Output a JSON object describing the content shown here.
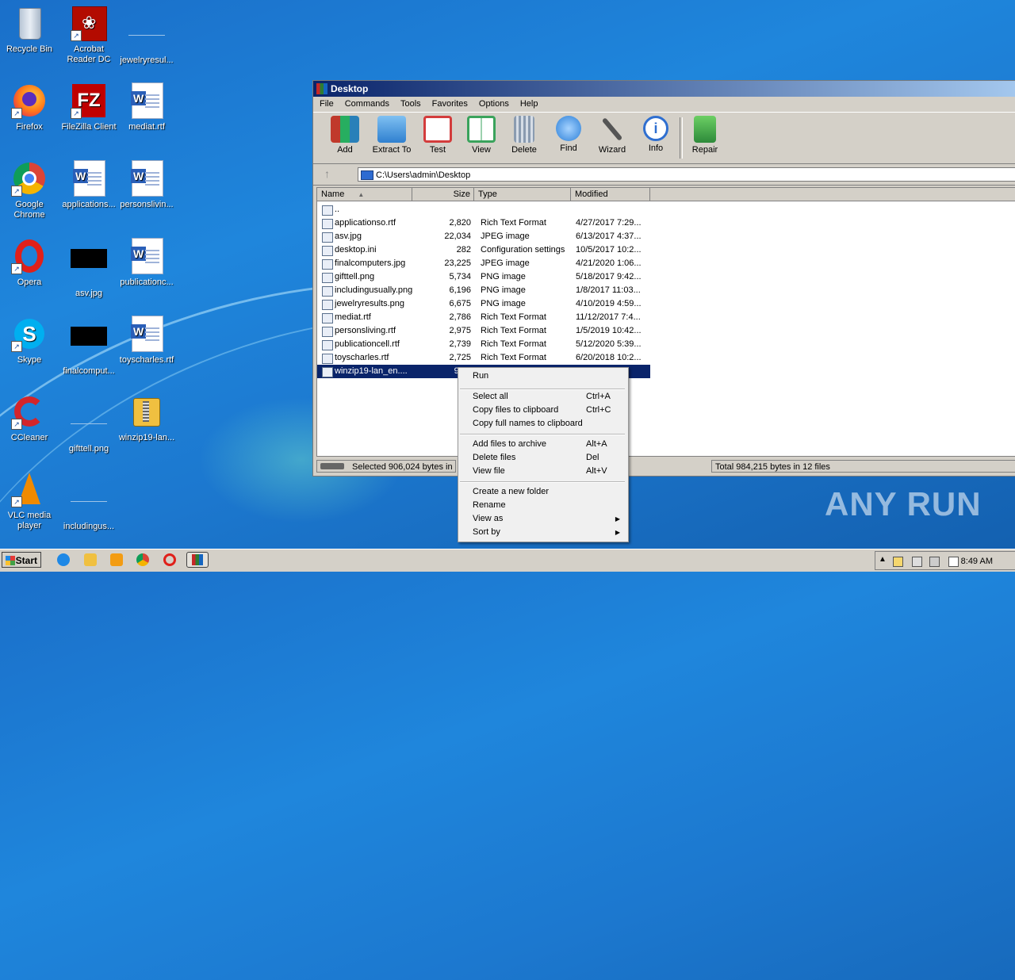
{
  "desktop": {
    "icons": [
      {
        "label": "Recycle Bin"
      },
      {
        "label": "Acrobat Reader DC"
      },
      {
        "label": "jewelryresul..."
      },
      {
        "label": "Firefox"
      },
      {
        "label": "FileZilla Client"
      },
      {
        "label": "mediat.rtf"
      },
      {
        "label": "Google Chrome"
      },
      {
        "label": "applications..."
      },
      {
        "label": "personslivin..."
      },
      {
        "label": "Opera"
      },
      {
        "label": "asv.jpg"
      },
      {
        "label": "publicationc..."
      },
      {
        "label": "Skype"
      },
      {
        "label": "finalcomput..."
      },
      {
        "label": "toyscharles.rtf"
      },
      {
        "label": "CCleaner"
      },
      {
        "label": "gifttell.png"
      },
      {
        "label": "winzip19-lan..."
      },
      {
        "label": "VLC media player"
      },
      {
        "label": "includingus..."
      }
    ]
  },
  "window": {
    "title": "Desktop",
    "menu": [
      "File",
      "Commands",
      "Tools",
      "Favorites",
      "Options",
      "Help"
    ],
    "toolbar": [
      {
        "label": "Add",
        "icon": "add-archive-icon",
        "color": "#c0392b"
      },
      {
        "label": "Extract To",
        "icon": "folder-icon",
        "color": "#3d8fd8"
      },
      {
        "label": "Test",
        "icon": "checklist-icon",
        "color": "#d33c3c"
      },
      {
        "label": "View",
        "icon": "book-icon",
        "color": "#3aa35c"
      },
      {
        "label": "Delete",
        "icon": "trash-icon",
        "color": "#8a9bb0"
      },
      {
        "label": "Find",
        "icon": "magnifier-icon",
        "color": "#2b7fd8"
      },
      {
        "label": "Wizard",
        "icon": "wand-icon",
        "color": "#7f8c8d"
      },
      {
        "label": "Info",
        "icon": "info-icon",
        "color": "#2f6fd0"
      },
      {
        "label": "Repair",
        "icon": "repair-icon",
        "color": "#3ea44a"
      }
    ],
    "address": "C:\\Users\\admin\\Desktop",
    "columns": {
      "name": "Name",
      "size": "Size",
      "type": "Type",
      "modified": "Modified"
    },
    "files": [
      {
        "name": "..",
        "size": "",
        "type": "",
        "modified": ""
      },
      {
        "name": "applicationso.rtf",
        "size": "2,820",
        "type": "Rich Text Format",
        "modified": "4/27/2017 7:29..."
      },
      {
        "name": "asv.jpg",
        "size": "22,034",
        "type": "JPEG image",
        "modified": "6/13/2017 4:37..."
      },
      {
        "name": "desktop.ini",
        "size": "282",
        "type": "Configuration settings",
        "modified": "10/5/2017 10:2..."
      },
      {
        "name": "finalcomputers.jpg",
        "size": "23,225",
        "type": "JPEG image",
        "modified": "4/21/2020 1:06..."
      },
      {
        "name": "gifttell.png",
        "size": "5,734",
        "type": "PNG image",
        "modified": "5/18/2017 9:42..."
      },
      {
        "name": "includingusually.png",
        "size": "6,196",
        "type": "PNG image",
        "modified": "1/8/2017 11:03..."
      },
      {
        "name": "jewelryresults.png",
        "size": "6,675",
        "type": "PNG image",
        "modified": "4/10/2019 4:59..."
      },
      {
        "name": "mediat.rtf",
        "size": "2,786",
        "type": "Rich Text Format",
        "modified": "11/12/2017 7:4..."
      },
      {
        "name": "personsliving.rtf",
        "size": "2,975",
        "type": "Rich Text Format",
        "modified": "1/5/2019 10:42..."
      },
      {
        "name": "publicationcell.rtf",
        "size": "2,739",
        "type": "Rich Text Format",
        "modified": "5/12/2020 5:39..."
      },
      {
        "name": "toyscharles.rtf",
        "size": "2,725",
        "type": "Rich Text Format",
        "modified": "6/20/2018 10:2..."
      },
      {
        "name": "winzip19-lan_en....",
        "size": "906,",
        "type": "",
        "modified": ""
      }
    ],
    "status_left": "Selected 906,024 bytes in 1",
    "status_right": "Total 984,215 bytes in 12 files"
  },
  "context_menu": {
    "items": [
      {
        "label": "Run",
        "shortcut": ""
      },
      {
        "label": "Select all",
        "shortcut": "Ctrl+A"
      },
      {
        "label": "Copy files to clipboard",
        "shortcut": "Ctrl+C"
      },
      {
        "label": "Copy full names to clipboard",
        "shortcut": ""
      },
      {
        "label": "Add files to archive",
        "shortcut": "Alt+A"
      },
      {
        "label": "Delete files",
        "shortcut": "Del"
      },
      {
        "label": "View file",
        "shortcut": "Alt+V"
      },
      {
        "label": "Create a new folder",
        "shortcut": ""
      },
      {
        "label": "Rename",
        "shortcut": ""
      },
      {
        "label": "View as",
        "shortcut": ""
      },
      {
        "label": "Sort by",
        "shortcut": ""
      }
    ]
  },
  "taskbar": {
    "start": "Start",
    "clock": "8:49 AM"
  },
  "watermark": "ANY RUN"
}
